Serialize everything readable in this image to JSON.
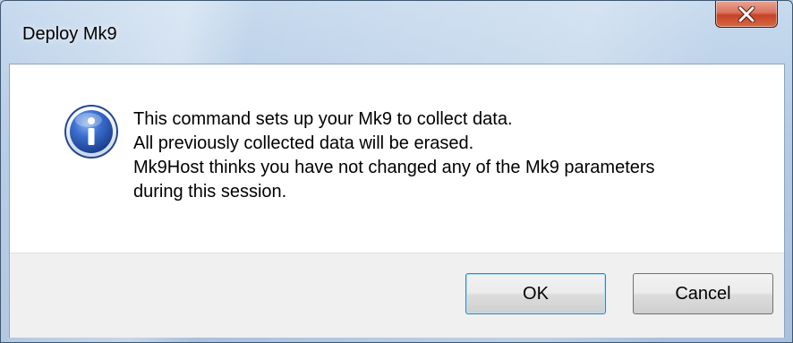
{
  "window": {
    "title": "Deploy Mk9"
  },
  "icons": {
    "message": "info-icon",
    "close": "close-icon"
  },
  "message": {
    "lines": [
      "This command sets up your Mk9 to collect data.",
      "All previously collected data will be erased.",
      "Mk9Host thinks you have not changed any of the Mk9 parameters",
      "during this session."
    ]
  },
  "buttons": {
    "ok_label": "OK",
    "cancel_label": "Cancel"
  },
  "colors": {
    "close_button": "#c64226",
    "info_icon": "#2a5cb5",
    "default_button_border": "#3c7fb1"
  }
}
